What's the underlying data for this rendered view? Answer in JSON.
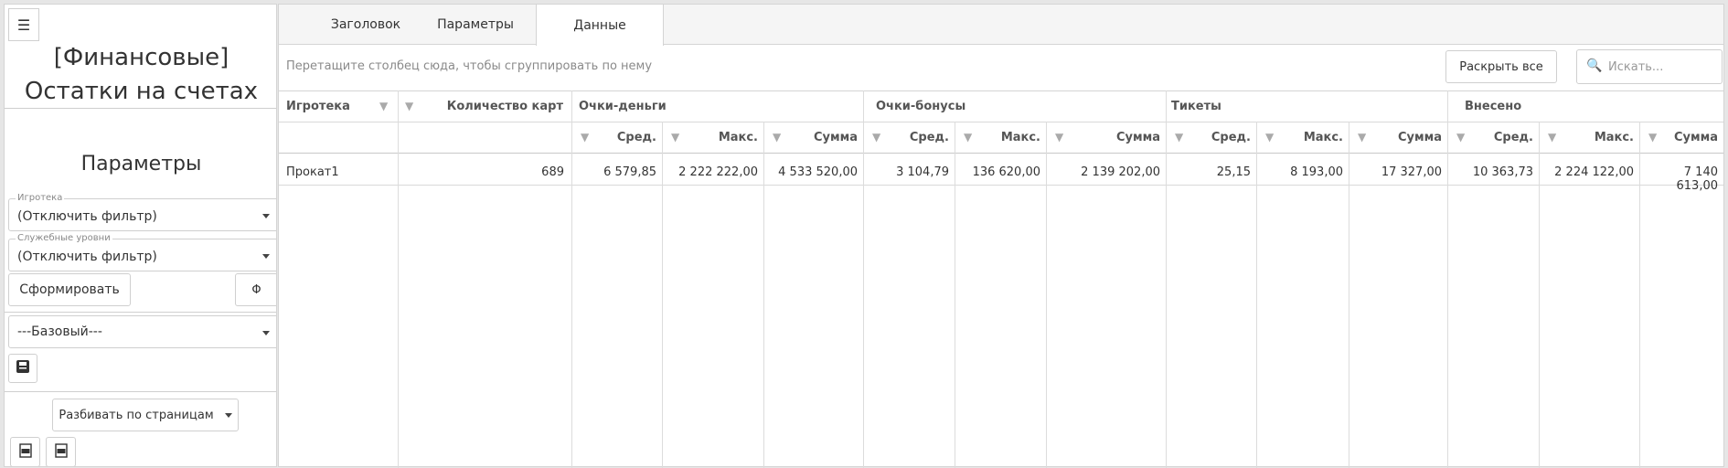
{
  "sidebar": {
    "toggle_icon": "menu-collapse-icon",
    "report_title": "[Финансовые] Остатки на счетах",
    "params_title": "Параметры",
    "filters": [
      {
        "label": "Игротека",
        "value": "(Отключить фильтр)"
      },
      {
        "label": "Служебные уровни",
        "value": "(Отключить фильтр)"
      }
    ],
    "generate_button": "Сформировать",
    "phi_button": "Φ",
    "preset": "---Базовый---",
    "save_icon": "save-icon",
    "paging_button": "Разбивать по страницам",
    "export_icons": [
      "csv-export-icon",
      "pdf-export-icon"
    ]
  },
  "tabs": [
    {
      "label": "Заголовок"
    },
    {
      "label": "Параметры"
    },
    {
      "label": "Данные",
      "active": true
    }
  ],
  "toolbar": {
    "group_hint": "Перетащите столбец сюда, чтобы сгруппировать по нему",
    "expand_all": "Раскрыть все",
    "search_placeholder": "Искать..."
  },
  "grid": {
    "col_game": "Игротека",
    "col_cards": "Количество карт",
    "groups": [
      "Очки-деньги",
      "Очки-бонусы",
      "Тикеты",
      "Внесено"
    ],
    "subcols": [
      "Сред.",
      "Макс.",
      "Сумма"
    ],
    "row": {
      "game": "Прокат1",
      "cards": "689",
      "values": [
        "6 579,85",
        "2 222 222,00",
        "4 533 520,00",
        "3 104,79",
        "136 620,00",
        "2 139 202,00",
        "25,15",
        "8 193,00",
        "17 327,00",
        "10 363,73",
        "2 224 122,00",
        "7 140 613,00"
      ]
    }
  }
}
